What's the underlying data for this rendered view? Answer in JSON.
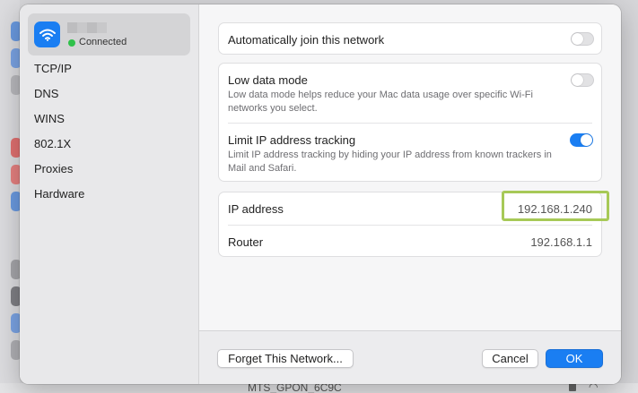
{
  "sidebar": {
    "network": {
      "status": "Connected",
      "icon": "wifi-icon"
    },
    "items": [
      {
        "label": "TCP/IP"
      },
      {
        "label": "DNS"
      },
      {
        "label": "WINS"
      },
      {
        "label": "802.1X"
      },
      {
        "label": "Proxies"
      },
      {
        "label": "Hardware"
      }
    ]
  },
  "settings": {
    "auto_join": {
      "label": "Automatically join this network",
      "enabled": false
    },
    "low_data": {
      "label": "Low data mode",
      "description": "Low data mode helps reduce your Mac data usage over specific Wi-Fi networks you select.",
      "enabled": false
    },
    "limit_ip": {
      "label": "Limit IP address tracking",
      "description": "Limit IP address tracking by hiding your IP address from known trackers in Mail and Safari.",
      "enabled": true
    }
  },
  "info": {
    "ip_label": "IP address",
    "ip_value": "192.168.1.240",
    "router_label": "Router",
    "router_value": "192.168.1.1"
  },
  "footer": {
    "forget_label": "Forget This Network...",
    "cancel_label": "Cancel",
    "ok_label": "OK"
  },
  "background": {
    "network_name": "MTS_GPON_6C9C"
  },
  "colors": {
    "accent": "#1a7ef2",
    "connected": "#2fc14a",
    "highlight": "#a7c957"
  }
}
